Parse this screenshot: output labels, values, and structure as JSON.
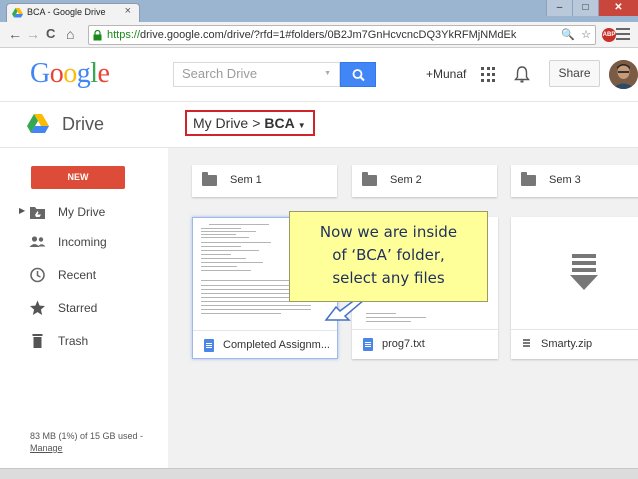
{
  "browser": {
    "tab_title": "BCA - Google Drive",
    "tab_close": "×",
    "url_scheme": "https://",
    "url_rest": "drive.google.com/drive/?rfd=1#folders/0B2Jm7GnHcvcncDQ3YkRFMjNMdEk",
    "abp_label": "ABP",
    "minimize": "–",
    "maximize": "□",
    "close": "✕",
    "back": "←",
    "forward": "→",
    "reload": "C",
    "home": "⌂",
    "zoom": "🔍",
    "star": "☆"
  },
  "header": {
    "logo": [
      "G",
      "o",
      "o",
      "g",
      "l",
      "e"
    ],
    "logo_colors": [
      "#4285f4",
      "#ea4335",
      "#fbbc05",
      "#4285f4",
      "#34a853",
      "#ea4335"
    ],
    "search_placeholder": "Search Drive",
    "search_dropdown": "▼",
    "user_name": "+Munaf",
    "share_label": "Share"
  },
  "subheader": {
    "drive_label": "Drive",
    "breadcrumb_root": "My Drive",
    "breadcrumb_sep": ">",
    "breadcrumb_current": "BCA",
    "breadcrumb_caret": "▼"
  },
  "sidebar": {
    "new_label": "NEW",
    "expand_arrow": "▶",
    "items": [
      {
        "label": "My Drive",
        "icon": "my-drive-icon"
      },
      {
        "label": "Incoming",
        "icon": "incoming-icon"
      },
      {
        "label": "Recent",
        "icon": "recent-icon"
      },
      {
        "label": "Starred",
        "icon": "star-icon"
      },
      {
        "label": "Trash",
        "icon": "trash-icon"
      }
    ],
    "storage_text": "83 MB (1%) of 15 GB used -",
    "manage_link": "Manage"
  },
  "main": {
    "folders": [
      "Sem 1",
      "Sem 2",
      "Sem 3"
    ],
    "files": [
      {
        "name": "Completed Assignm...",
        "type": "doc"
      },
      {
        "name": "prog7.txt",
        "type": "doc"
      },
      {
        "name": "Smarty.zip",
        "type": "zip"
      }
    ]
  },
  "callout": {
    "lines": [
      "Now we are inside",
      "of ‘BCA’ folder,",
      "select any files"
    ]
  },
  "colors": {
    "accent_blue": "#4285f4",
    "new_red": "#dd4b39",
    "highlight_red": "#d1232a",
    "callout_yellow": "#ffff99"
  }
}
